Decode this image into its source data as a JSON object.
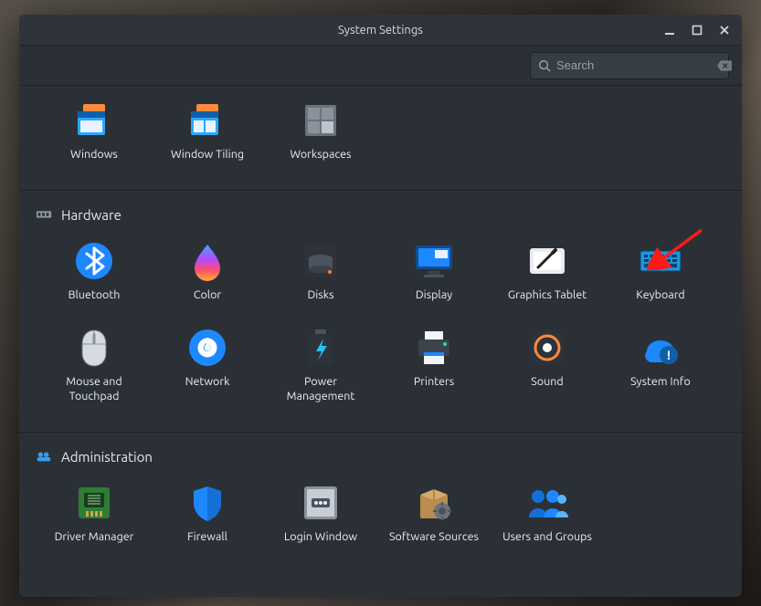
{
  "window": {
    "title": "System Settings"
  },
  "search": {
    "placeholder": "Search"
  },
  "sections": {
    "top": {
      "items": [
        {
          "label": "Windows"
        },
        {
          "label": "Window Tiling"
        },
        {
          "label": "Workspaces"
        }
      ]
    },
    "hardware": {
      "title": "Hardware",
      "items": [
        {
          "label": "Bluetooth"
        },
        {
          "label": "Color"
        },
        {
          "label": "Disks"
        },
        {
          "label": "Display"
        },
        {
          "label": "Graphics Tablet"
        },
        {
          "label": "Keyboard"
        },
        {
          "label": "Mouse and Touchpad"
        },
        {
          "label": "Network"
        },
        {
          "label": "Power Management"
        },
        {
          "label": "Printers"
        },
        {
          "label": "Sound"
        },
        {
          "label": "System Info"
        }
      ]
    },
    "administration": {
      "title": "Administration",
      "items": [
        {
          "label": "Driver Manager"
        },
        {
          "label": "Firewall"
        },
        {
          "label": "Login Window"
        },
        {
          "label": "Software Sources"
        },
        {
          "label": "Users and Groups"
        }
      ]
    }
  }
}
